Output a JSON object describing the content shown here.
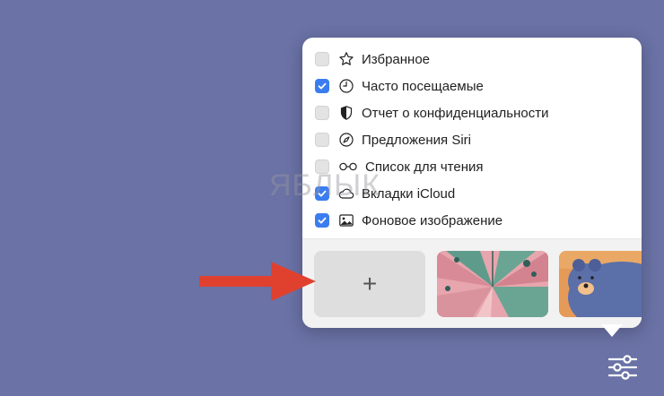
{
  "menu": {
    "items": [
      {
        "label": "Избранное",
        "checked": false,
        "icon": "star-icon"
      },
      {
        "label": "Часто посещаемые",
        "checked": true,
        "icon": "clock-icon"
      },
      {
        "label": "Отчет о конфиденциальности",
        "checked": false,
        "icon": "shield-icon"
      },
      {
        "label": "Предложения Siri",
        "checked": false,
        "icon": "compass-icon"
      },
      {
        "label": "Список для чтения",
        "checked": false,
        "icon": "glasses-icon"
      },
      {
        "label": "Вкладки iCloud",
        "checked": true,
        "icon": "cloud-icon"
      },
      {
        "label": "Фоновое изображение",
        "checked": true,
        "icon": "image-icon"
      }
    ]
  },
  "background_picker": {
    "add_label": "+",
    "thumbnails": [
      "butterfly-wallpaper",
      "bear-wallpaper"
    ]
  },
  "watermark": "ЯБЛЫК",
  "colors": {
    "desktop": "#6a72a6",
    "accent": "#3b7df0",
    "arrow": "#e0412f"
  }
}
